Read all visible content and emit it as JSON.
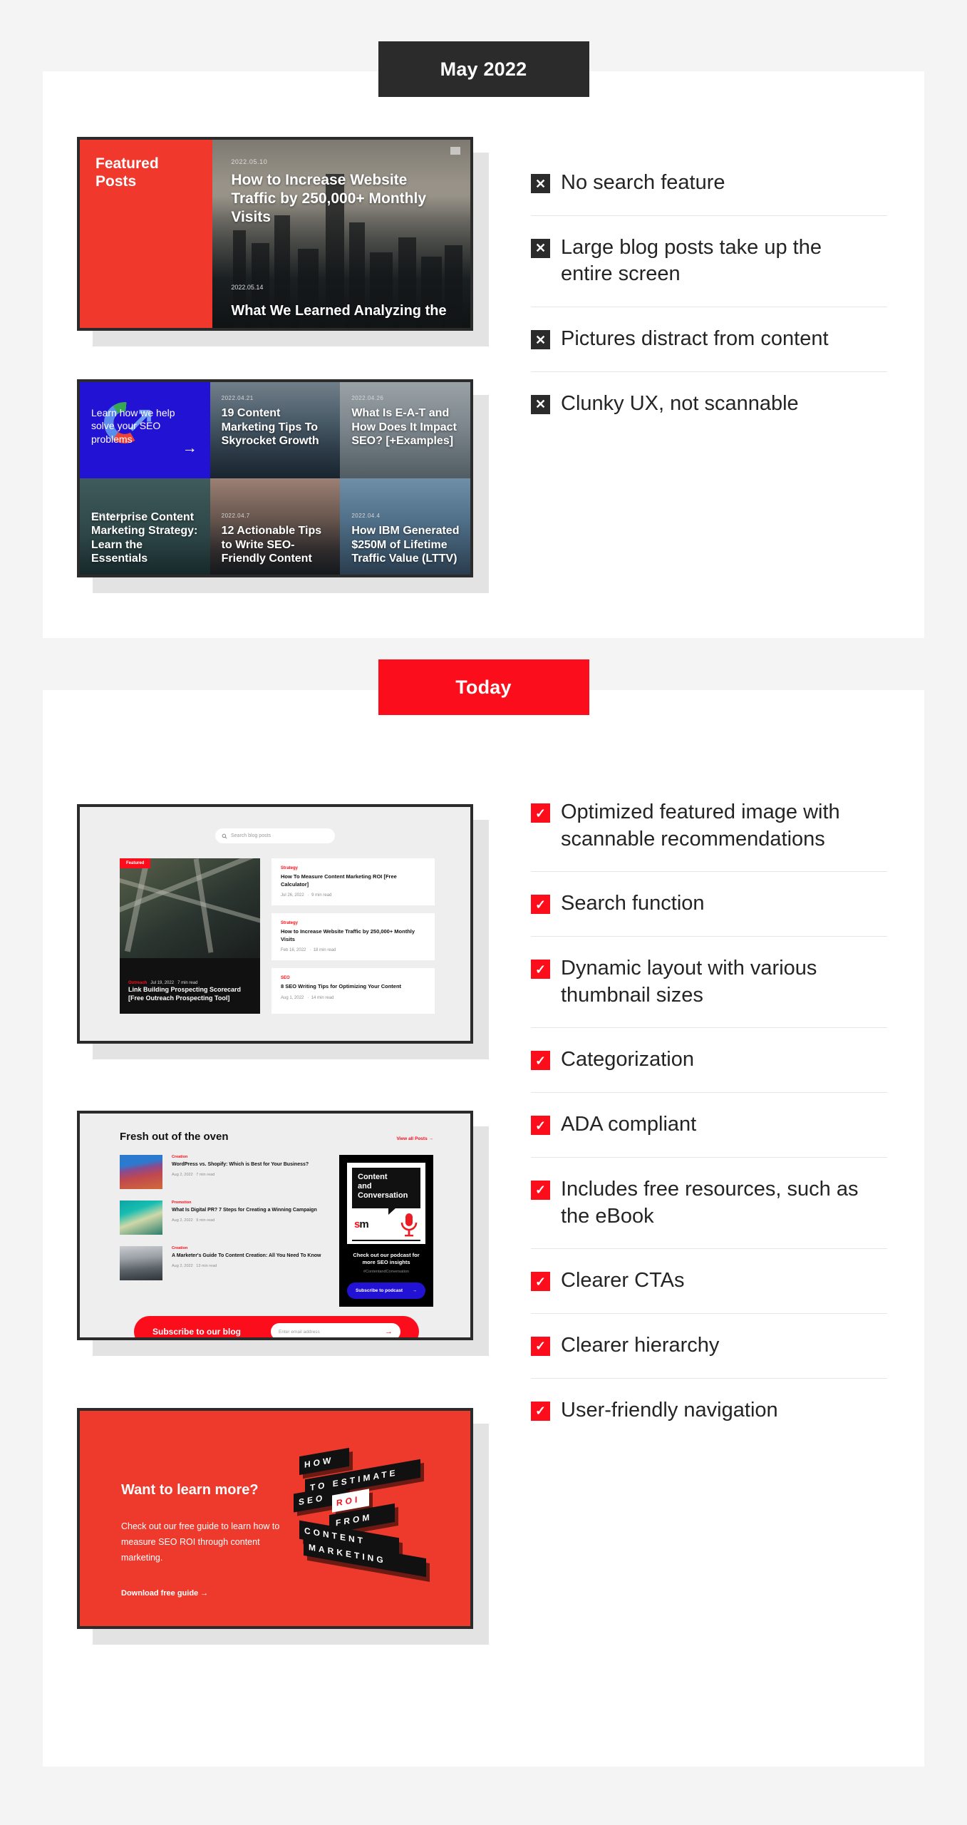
{
  "theme": {
    "bg": "#f4f4f4",
    "panel": "#ffffff",
    "dark": "#2b2b2b",
    "red": "#fb0d1b",
    "cta_red": "#ee3a2d",
    "blue": "#2212d4"
  },
  "sections": [
    {
      "badge": "May 2022",
      "badge_style": "dark",
      "items": [
        {
          "mark": "x-icon",
          "text": "No search feature"
        },
        {
          "mark": "x-icon",
          "text": "Large blog posts take up the entire screen"
        },
        {
          "mark": "x-icon",
          "text": "Pictures distract from content"
        },
        {
          "mark": "x-icon",
          "text": "Clunky UX, not scannable"
        }
      ]
    },
    {
      "badge": "Today",
      "badge_style": "red",
      "items": [
        {
          "mark": "check-icon",
          "text": "Optimized featured image with scannable recommendations"
        },
        {
          "mark": "check-icon",
          "text": "Search function"
        },
        {
          "mark": "check-icon",
          "text": "Dynamic layout with various thumbnail sizes"
        },
        {
          "mark": "check-icon",
          "text": "Categorization"
        },
        {
          "mark": "check-icon",
          "text": "ADA compliant"
        },
        {
          "mark": "check-icon",
          "text": "Includes free resources, such as the eBook"
        },
        {
          "mark": "check-icon",
          "text": "Clearer CTAs"
        },
        {
          "mark": "check-icon",
          "text": "Clearer hierarchy"
        },
        {
          "mark": "check-icon",
          "text": "User-friendly navigation"
        }
      ]
    }
  ],
  "shot_hero": {
    "label": "Featured\nPosts",
    "label_line1": "Featured",
    "label_line2": "Posts",
    "post1_date": "2022.05.10",
    "post1_title": "How to Increase Website Traffic by 250,000+ Monthly Visits",
    "post2_date": "2022.05.14",
    "post2_title": "What We Learned Analyzing the"
  },
  "shot_grid": {
    "promo_text": "Learn how we help solve your SEO problems",
    "promo_arrow": "→",
    "cells": [
      {
        "date": "2022.04.21",
        "title": "19 Content Marketing Tips To Skyrocket Growth"
      },
      {
        "date": "2022.04.26",
        "title": "What Is E-A-T and How Does It Impact SEO? [+Examples]"
      },
      {
        "date": "2022.04.13",
        "title": "Enterprise Content Marketing Strategy: Learn the Essentials"
      },
      {
        "date": "2022.04.7",
        "title": "12 Actionable Tips to Write SEO-Friendly Content"
      },
      {
        "date": "2022.04.4",
        "title": "How IBM Generated $250M of Lifetime Traffic Value (LTTV)"
      }
    ]
  },
  "shot_search": {
    "search_placeholder": "Search blog posts",
    "featured_tag": "Featured",
    "featured_category": "Outreach",
    "featured_date": "Jul 19, 2022",
    "featured_read": "7 min read",
    "featured_title": "Link Building Prospecting Scorecard [Free Outreach Prospecting Tool]",
    "cards": [
      {
        "category": "Strategy",
        "title": "How To Measure Content Marketing ROI [Free Calculator]",
        "date": "Jul 26, 2022",
        "read": "9 min read"
      },
      {
        "category": "Strategy",
        "title": "How to Increase Website Traffic by 250,000+ Monthly Visits",
        "date": "Feb 16, 2022",
        "read": "18 min read"
      },
      {
        "category": "SEO",
        "title": "8 SEO Writing Tips for Optimizing Your Content",
        "date": "Aug 1, 2022",
        "read": "14 min read"
      }
    ]
  },
  "shot_oven": {
    "heading": "Fresh out of the oven",
    "view_all": "View all Posts →",
    "posts": [
      {
        "category": "Creation",
        "title": "WordPress vs. Shopify: Which is Best for Your Business?",
        "date": "Aug 2, 2022",
        "read": "7 min read"
      },
      {
        "category": "Promotion",
        "title": "What Is Digital PR? 7 Steps for Creating a Winning Campaign",
        "date": "Aug 2, 2022",
        "read": "9 min read"
      },
      {
        "category": "Creation",
        "title": "A Marketer's Guide To Content Creation: All You Need To Know",
        "date": "Aug 2, 2022",
        "read": "13 min read"
      }
    ],
    "podcast": {
      "art_line1": "Content",
      "art_line2": "and",
      "art_line3": "Conversation",
      "brand": "sm",
      "caption": "Check out our podcast for more SEO insights",
      "hashtag": "#ContentandConversation",
      "button": "Subscribe to podcast",
      "button_arrow": "→"
    },
    "subscribe": {
      "label": "Subscribe to our blog",
      "placeholder": "Enter email address",
      "arrow": "→"
    }
  },
  "shot_cta": {
    "heading": "Want to learn more?",
    "body": "Check out our free guide to learn how to measure SEO ROI through content marketing.",
    "link": "Download free guide →",
    "cover_words": [
      "HOW",
      "TO ESTIMATE",
      "SEO",
      "ROI",
      "FROM",
      "CONTENT",
      "MARKETING"
    ]
  }
}
